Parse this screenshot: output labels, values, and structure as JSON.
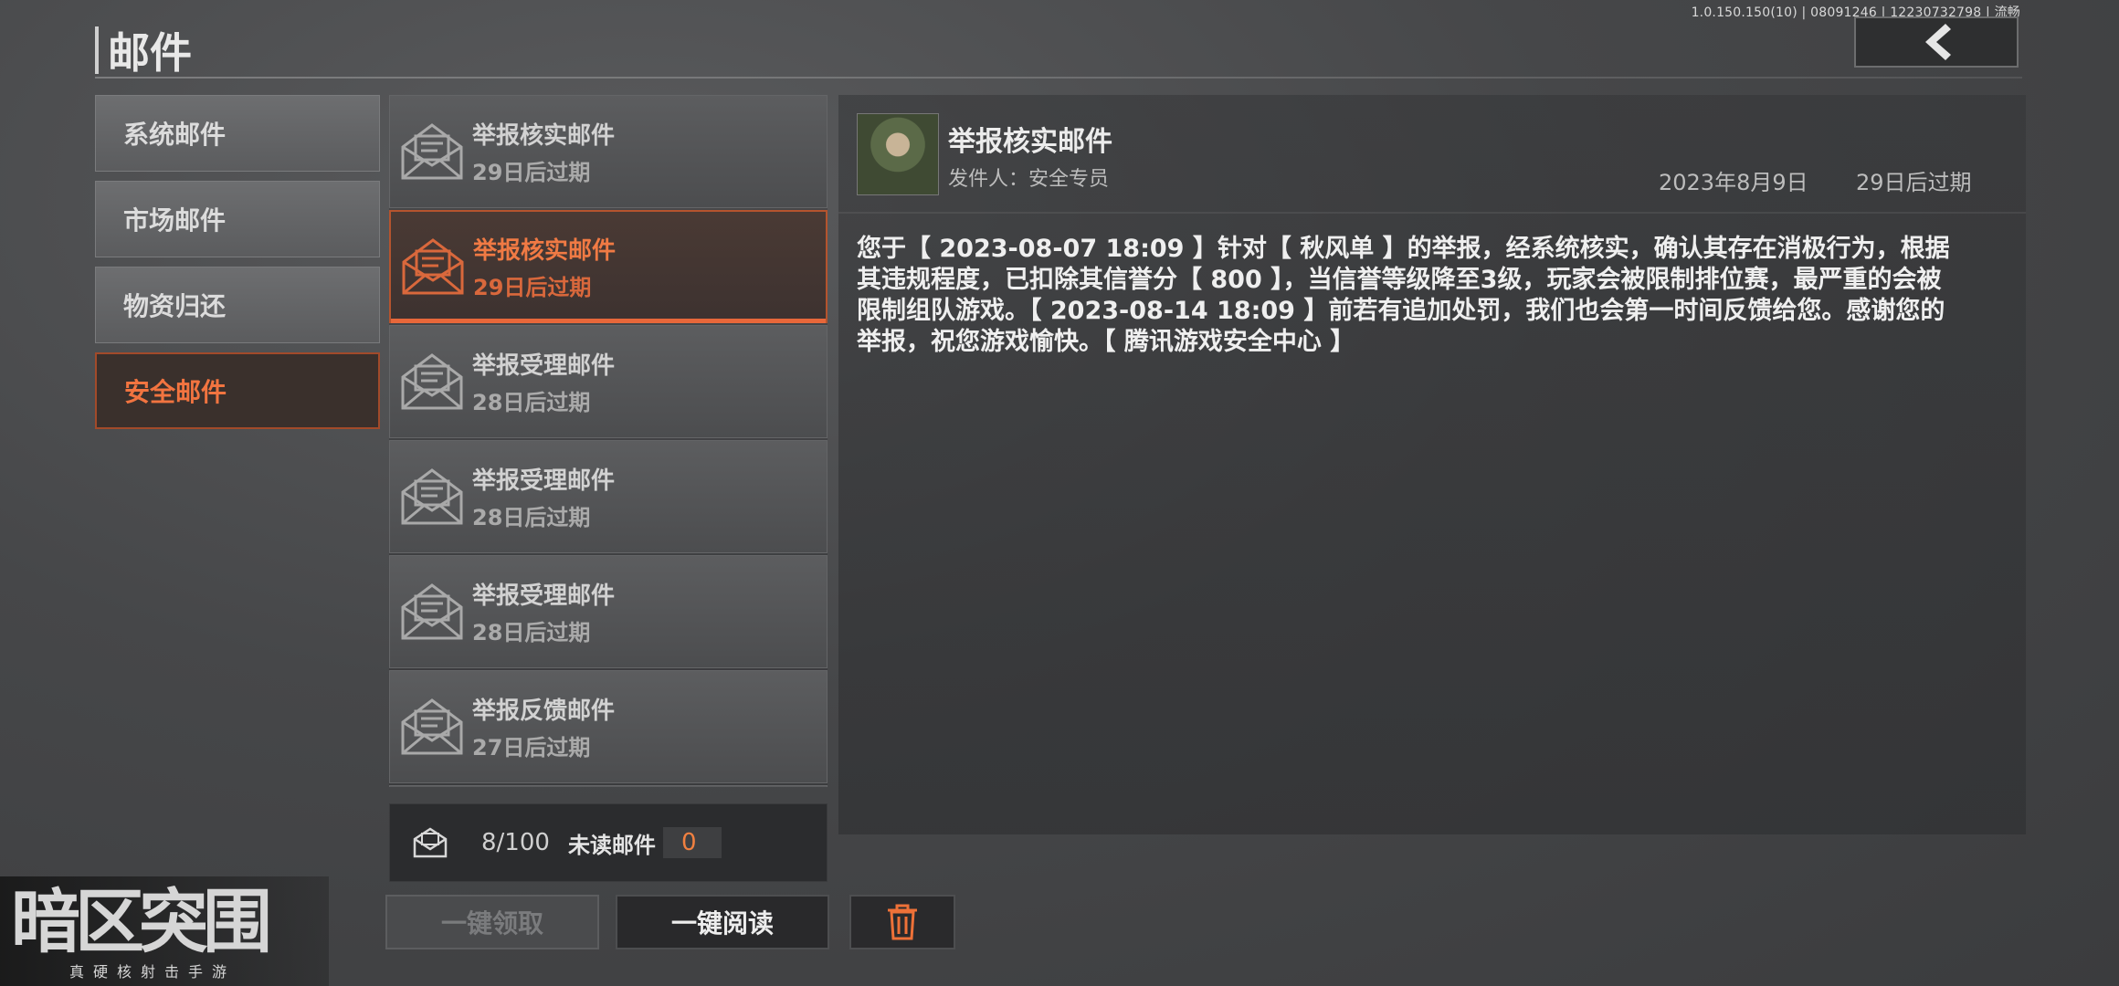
{
  "app": {
    "title": "邮件",
    "version": "1.0.150.150(10) | 08091246 | 12230732798 | 流畅",
    "logo_text": "暗区突围",
    "logo_subtitle": "真硬核射击手游"
  },
  "categories": [
    {
      "label": "系统邮件",
      "active": false
    },
    {
      "label": "市场邮件",
      "active": false
    },
    {
      "label": "物资归还",
      "active": false
    },
    {
      "label": "安全邮件",
      "active": true
    }
  ],
  "mails": [
    {
      "title": "举报核实邮件",
      "expire": "29日后过期",
      "active": false
    },
    {
      "title": "举报核实邮件",
      "expire": "29日后过期",
      "active": true
    },
    {
      "title": "举报受理邮件",
      "expire": "28日后过期",
      "active": false
    },
    {
      "title": "举报受理邮件",
      "expire": "28日后过期",
      "active": false
    },
    {
      "title": "举报受理邮件",
      "expire": "28日后过期",
      "active": false
    },
    {
      "title": "举报反馈邮件",
      "expire": "27日后过期",
      "active": false
    }
  ],
  "footer": {
    "count": "8/100",
    "unread_label": "未读邮件",
    "unread_count": "0"
  },
  "buttons": {
    "claim_all": "一键领取",
    "read_all": "一键阅读"
  },
  "detail": {
    "title": "举报核实邮件",
    "sender": "发件人：安全专员",
    "date": "2023年8月9日",
    "expire": "29日后过期",
    "body": "您于【 2023-08-07 18:09 】针对【 秋风单 】的举报，经系统核实，确认其存在消极行为，根据其违规程度，已扣除其信誉分【 800 】，当信誉等级降至3级，玩家会被限制排位赛，最严重的会被限制组队游戏。【 2023-08-14 18:09 】前若有追加处罚，我们也会第一时间反馈给您。感谢您的举报，祝您游戏愉快。【 腾讯游戏安全中心 】"
  },
  "colors": {
    "accent": "#f07440",
    "active_border": "#b5542e"
  },
  "icons": {
    "back": "chevron-left-icon",
    "mail": "envelope-open-icon",
    "footer": "mailbox-icon",
    "delete": "trash-icon"
  }
}
